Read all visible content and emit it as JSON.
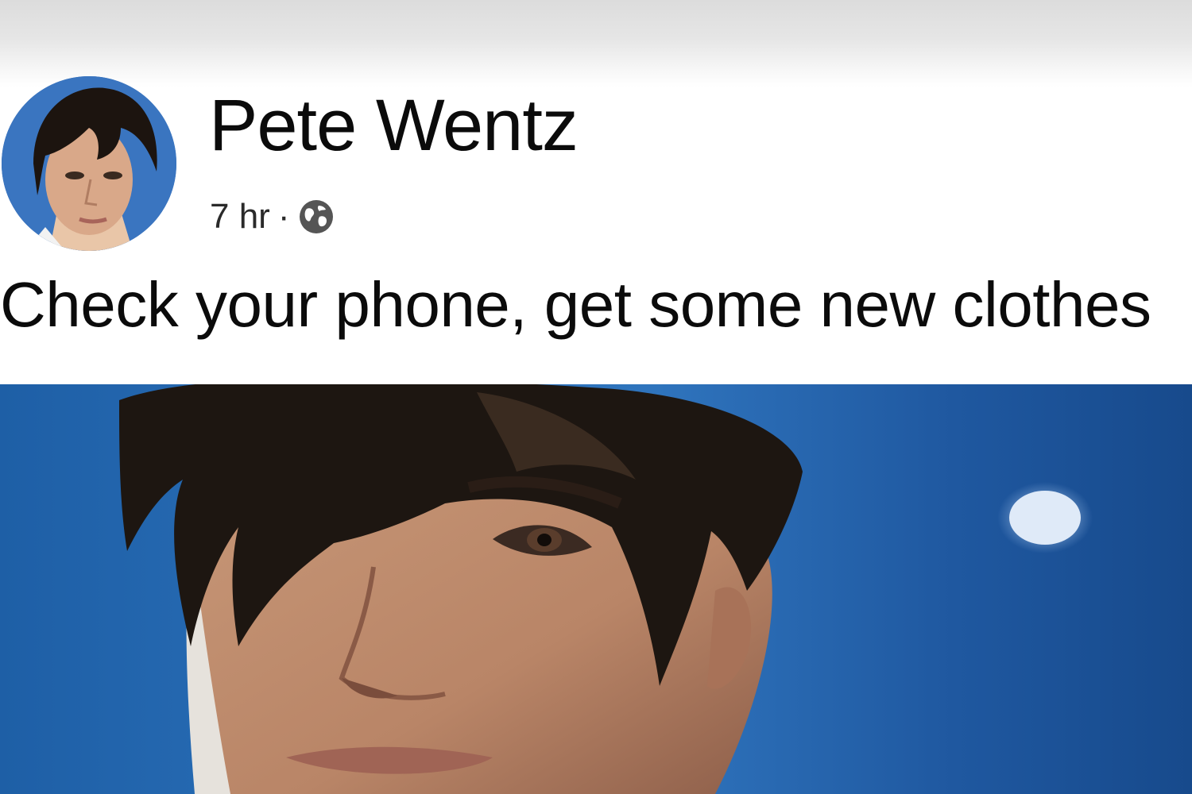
{
  "post": {
    "author": "Pete Wentz",
    "timestamp": "7 hr",
    "separator": "·",
    "privacy_icon": "globe-icon",
    "text": "Check your phone, get some new clothes"
  },
  "colors": {
    "photo_background": "#2a6fb8",
    "text": "#0b0b0b"
  }
}
